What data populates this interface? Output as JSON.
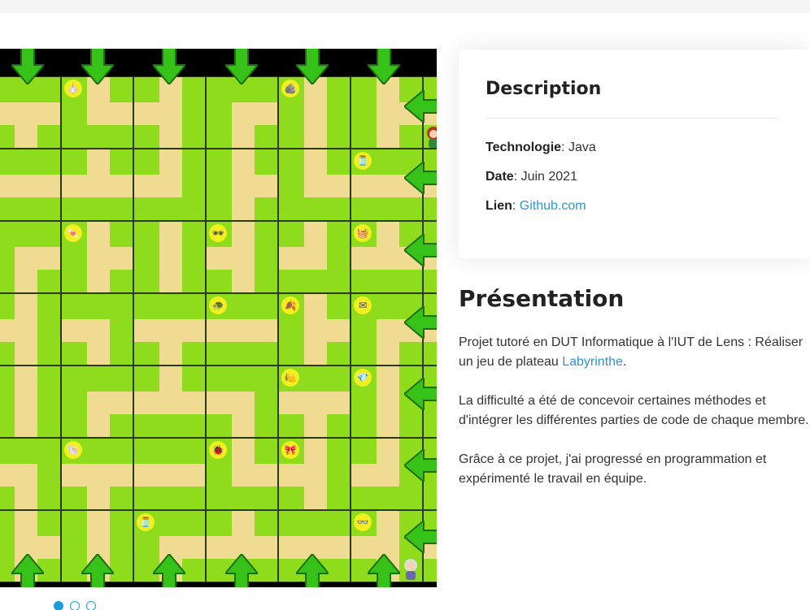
{
  "gallery": {
    "items": [
      "🧄",
      "🪨",
      "🫙",
      "🍬",
      "🕶",
      "🧺",
      "🐢",
      "🍂",
      "✉",
      "🍋",
      "💎",
      "🐚",
      "🐞",
      "🎀",
      "🫙",
      "👓"
    ],
    "slides": 3,
    "active_slide": 1
  },
  "description": {
    "title": "Description",
    "tech_label": "Technologie",
    "tech_value": ": Java",
    "date_label": "Date",
    "date_value": ": Juin 2021",
    "link_label": "Lien",
    "link_sep": ": ",
    "link_text": "Github.com"
  },
  "presentation": {
    "title": "Présentation",
    "p1_a": "Projet tutoré en DUT Informatique à l'IUT de Lens : Réaliser un jeu de plateau ",
    "p1_link": "Labyrinthe",
    "p1_b": ".",
    "p2": "La difficulté a été de concevoir certaines méthodes et d'intégrer les différentes parties de code de chaque membre.",
    "p3": "Grâce à ce projet, j'ai progressé en programmation et expérimenté le travail en équipe."
  }
}
